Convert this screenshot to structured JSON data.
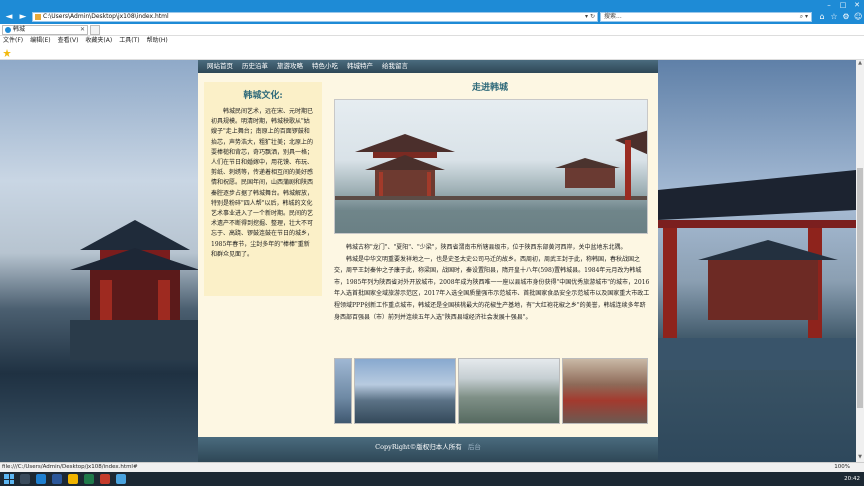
{
  "browser": {
    "url": "C:\\Users\\Admin\\Desktop\\jx108\\index.html",
    "search_placeholder": "搜索...",
    "tab_title": "韩城",
    "menu": [
      "文件(F)",
      "编辑(E)",
      "查看(V)",
      "收藏夹(A)",
      "工具(T)",
      "帮助(H)"
    ],
    "status_url": "file:///C:/Users/Admin/Desktop/jx108/index.html#",
    "zoom": "100%",
    "clock": "20:42"
  },
  "site": {
    "nav": [
      "网站首页",
      "历史沿革",
      "旅游攻略",
      "特色小吃",
      "韩城特产",
      "给我留言"
    ],
    "left_title": "韩城文化:",
    "left_text": "韩城民间艺术，远在宋、元时期已初具规模。明清时期，韩城秧歌从\"姑嫂子\"走上舞台；南原上的百面锣鼓和抬芯，声势浩大，粗犷壮美；北原上的耍棒槌和背芯，奇巧飘洒，别具一格；人们在节日和婚嫁中，用花馍、布玩、剪纸、刺绣等，传递着相互间的美好感情和祝愿。民国年间，山西蒲剧和陕西秦腔逐步占据了韩城舞台。韩城解放，特别是粉碎\"四人帮\"以后，韩城的文化艺术事业进入了一个新时期。民间的艺术遗产不断得到挖掘、整理，壮大不可忘于、高跷、锣鼓连鼓在节日的城乡，1985年春节，尘封多年的\"棒棒\"重新和群众见面了。",
    "right_title": "走进韩城",
    "article": [
      "韩城古称\"龙门\"、\"夏阳\"、\"少梁\"，陕西省渭南市所辖县级市，位于陕西东部黄河西岸，关中盆地东北隅。",
      "韩城是中华文明重要发祥地之一，也是史圣太史公司马迁的故乡。西周初，周武王封于此，称韩国，春秋战国之交，周平王封秦仲之子康于此，称梁国，战国时，秦设置阳县，隋开皇十八年(598)置韩城县。1984年元月改为韩城市，1985年列为陕西省对外开放城市，2008年成为陕西唯一一座以县城市身份获得\"中国优秀旅游城市\"的城市，2016年入选首批国家全域旅游示范区，2017年入选全国质量强市示范城市、首批国家食品安全示范城市以及国家重大市政工程领域PPP创新工作重点城市，韩城还是全国核桃最大的花椒生产基地，有\"大红袍花椒之乡\"的美誉，韩城连续多年跻身西部百强县（市）前列并连续五年入选\"陕西县域经济社会发展十强县\"。"
    ],
    "footer": "CopyRight©版权归本人所有",
    "footer_link": "后台"
  }
}
